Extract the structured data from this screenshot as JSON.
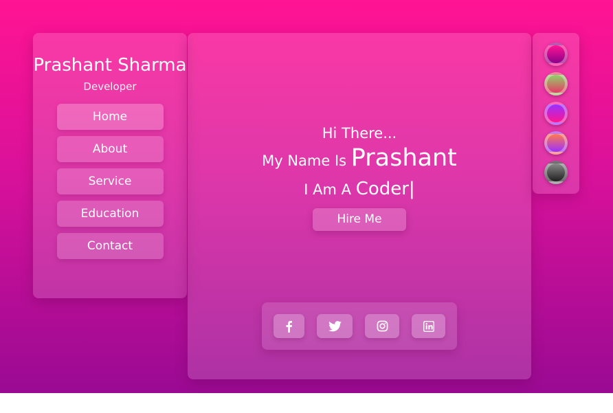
{
  "profile": {
    "name": "Prashant Sharma",
    "role": "Developer"
  },
  "nav": {
    "items": [
      {
        "label": "Home"
      },
      {
        "label": "About"
      },
      {
        "label": "Service"
      },
      {
        "label": "Education"
      },
      {
        "label": "Contact"
      }
    ]
  },
  "hero": {
    "greeting": "Hi There...",
    "name_prefix": "My Name Is",
    "name": "Prashant",
    "role_prefix": "I Am A",
    "role": "Coder",
    "caret": "|",
    "cta_label": "Hire Me"
  },
  "socials": [
    {
      "icon": "facebook-icon"
    },
    {
      "icon": "twitter-icon"
    },
    {
      "icon": "instagram-icon"
    },
    {
      "icon": "linkedin-icon"
    }
  ],
  "theme_swatches": [
    {
      "name": "magenta",
      "colors": [
        "#ff1493",
        "#8b008b"
      ]
    },
    {
      "name": "green-red",
      "colors": [
        "#8fd36a",
        "#e83a64"
      ]
    },
    {
      "name": "purple-pink",
      "colors": [
        "#9b30ff",
        "#ff1493"
      ]
    },
    {
      "name": "orange-purple",
      "colors": [
        "#ff7a4d",
        "#9b30ff"
      ]
    },
    {
      "name": "gray",
      "colors": [
        "#8a8a8a",
        "#1f1f1f"
      ]
    }
  ]
}
